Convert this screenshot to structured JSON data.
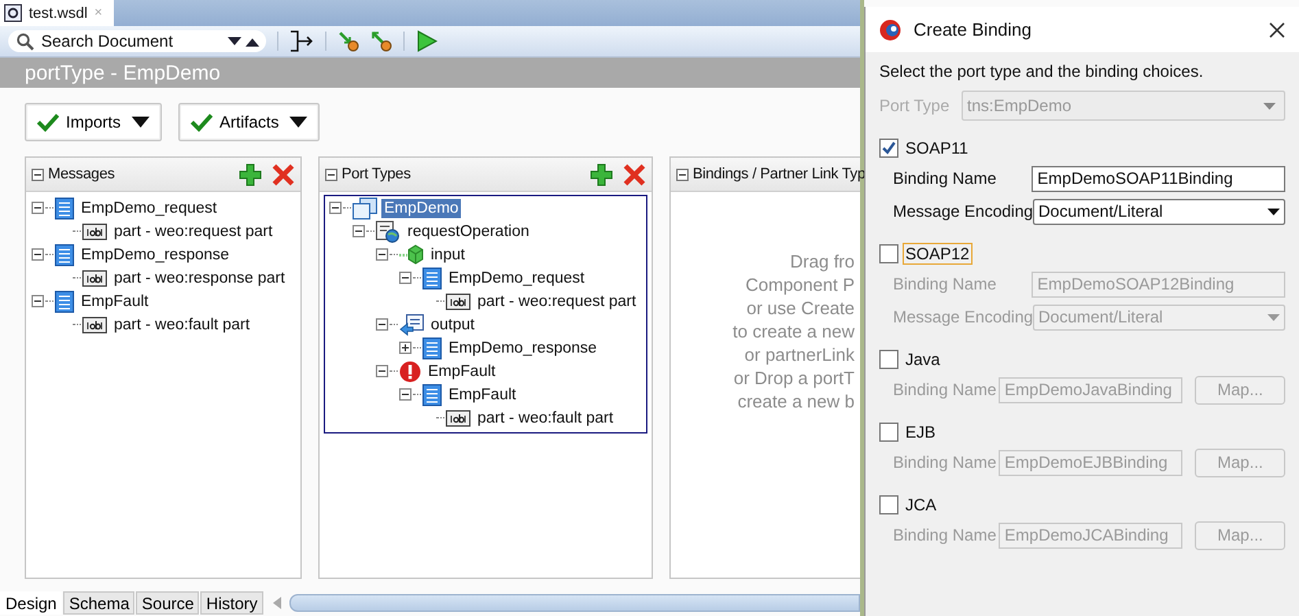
{
  "editor_tab": {
    "title": "test.wsdl",
    "close": "×"
  },
  "toolbar": {
    "search": {
      "placeholder": "Search Document"
    }
  },
  "header": {
    "title": "portType - EmpDemo"
  },
  "buttons": [
    {
      "label": "Imports"
    },
    {
      "label": "Artifacts"
    }
  ],
  "messages": {
    "title": "Messages",
    "tree": [
      {
        "kind": "message",
        "label": "EmpDemo_request",
        "selected": false,
        "expanded": true,
        "children": [
          {
            "kind": "part",
            "label": "part - weo:request part",
            "selected": false
          }
        ]
      },
      {
        "kind": "message",
        "label": "EmpDemo_response",
        "selected": false,
        "expanded": true,
        "children": [
          {
            "kind": "part",
            "label": "part - weo:response part",
            "selected": false
          }
        ]
      },
      {
        "kind": "message",
        "label": "EmpFault",
        "selected": false,
        "expanded": true,
        "children": [
          {
            "kind": "part",
            "label": "part - weo:fault part",
            "selected": false
          }
        ]
      }
    ]
  },
  "port_types": {
    "title": "Port Types",
    "tree": [
      {
        "kind": "porttype",
        "label": "EmpDemo",
        "selected": true,
        "expanded": true,
        "children": [
          {
            "kind": "operation",
            "label": "requestOperation",
            "selected": false,
            "expanded": true,
            "children": [
              {
                "kind": "input",
                "label": "input",
                "selected": false,
                "expanded": true,
                "children": [
                  {
                    "kind": "message",
                    "label": "EmpDemo_request",
                    "selected": false,
                    "expanded": true,
                    "children": [
                      {
                        "kind": "part",
                        "label": "part - weo:request part",
                        "selected": false
                      }
                    ]
                  }
                ]
              },
              {
                "kind": "output",
                "label": "output",
                "selected": false,
                "expanded": true,
                "children": [
                  {
                    "kind": "message",
                    "label": "EmpDemo_response",
                    "selected": false,
                    "expanded": false
                  }
                ]
              },
              {
                "kind": "fault",
                "label": "EmpFault",
                "selected": false,
                "expanded": true,
                "children": [
                  {
                    "kind": "message",
                    "label": "EmpFault",
                    "selected": false,
                    "expanded": true,
                    "children": [
                      {
                        "kind": "part",
                        "label": "part - weo:fault part",
                        "selected": false
                      }
                    ]
                  }
                ]
              }
            ]
          }
        ]
      }
    ]
  },
  "bindings_panel": {
    "title": "Bindings / Partner Link Typ",
    "hint_lines": [
      "Drag fro",
      "Component P",
      "or use Create",
      "to create a new",
      "or partnerLink",
      "or Drop a portT",
      "create a new b"
    ]
  },
  "bottom_tabs": [
    {
      "label": "Design",
      "selected": true
    },
    {
      "label": "Schema",
      "selected": false
    },
    {
      "label": "Source",
      "selected": false
    },
    {
      "label": "History",
      "selected": false
    }
  ],
  "dialog": {
    "title": "Create Binding",
    "instruction": "Select the port type and the binding choices.",
    "port_type": {
      "label": "Port Type",
      "value": "tns:EmpDemo",
      "disabled": true
    },
    "bindings": [
      {
        "label": "SOAP11",
        "checked": true,
        "focused": false,
        "fields": [
          {
            "kind": "text",
            "label": "Binding Name",
            "value": "EmpDemoSOAP11Binding"
          },
          {
            "kind": "select",
            "label": "Message Encoding",
            "value": "Document/Literal"
          }
        ]
      },
      {
        "label": "SOAP12",
        "checked": false,
        "focused": true,
        "fields": [
          {
            "kind": "text",
            "label": "Binding Name",
            "value": "EmpDemoSOAP12Binding"
          },
          {
            "kind": "select",
            "label": "Message Encoding",
            "value": "Document/Literal"
          }
        ]
      },
      {
        "label": "Java",
        "checked": false,
        "focused": false,
        "fields": [
          {
            "kind": "mapped",
            "label": "Binding Name",
            "value": "EmpDemoJavaBinding",
            "button": "Map..."
          }
        ]
      },
      {
        "label": "EJB",
        "checked": false,
        "focused": false,
        "fields": [
          {
            "kind": "mapped",
            "label": "Binding Name",
            "value": "EmpDemoEJBBinding",
            "button": "Map..."
          }
        ]
      },
      {
        "label": "JCA",
        "checked": false,
        "focused": false,
        "fields": [
          {
            "kind": "mapped",
            "label": "Binding Name",
            "value": "EmpDemoJCABinding",
            "button": "Map..."
          }
        ]
      }
    ]
  }
}
